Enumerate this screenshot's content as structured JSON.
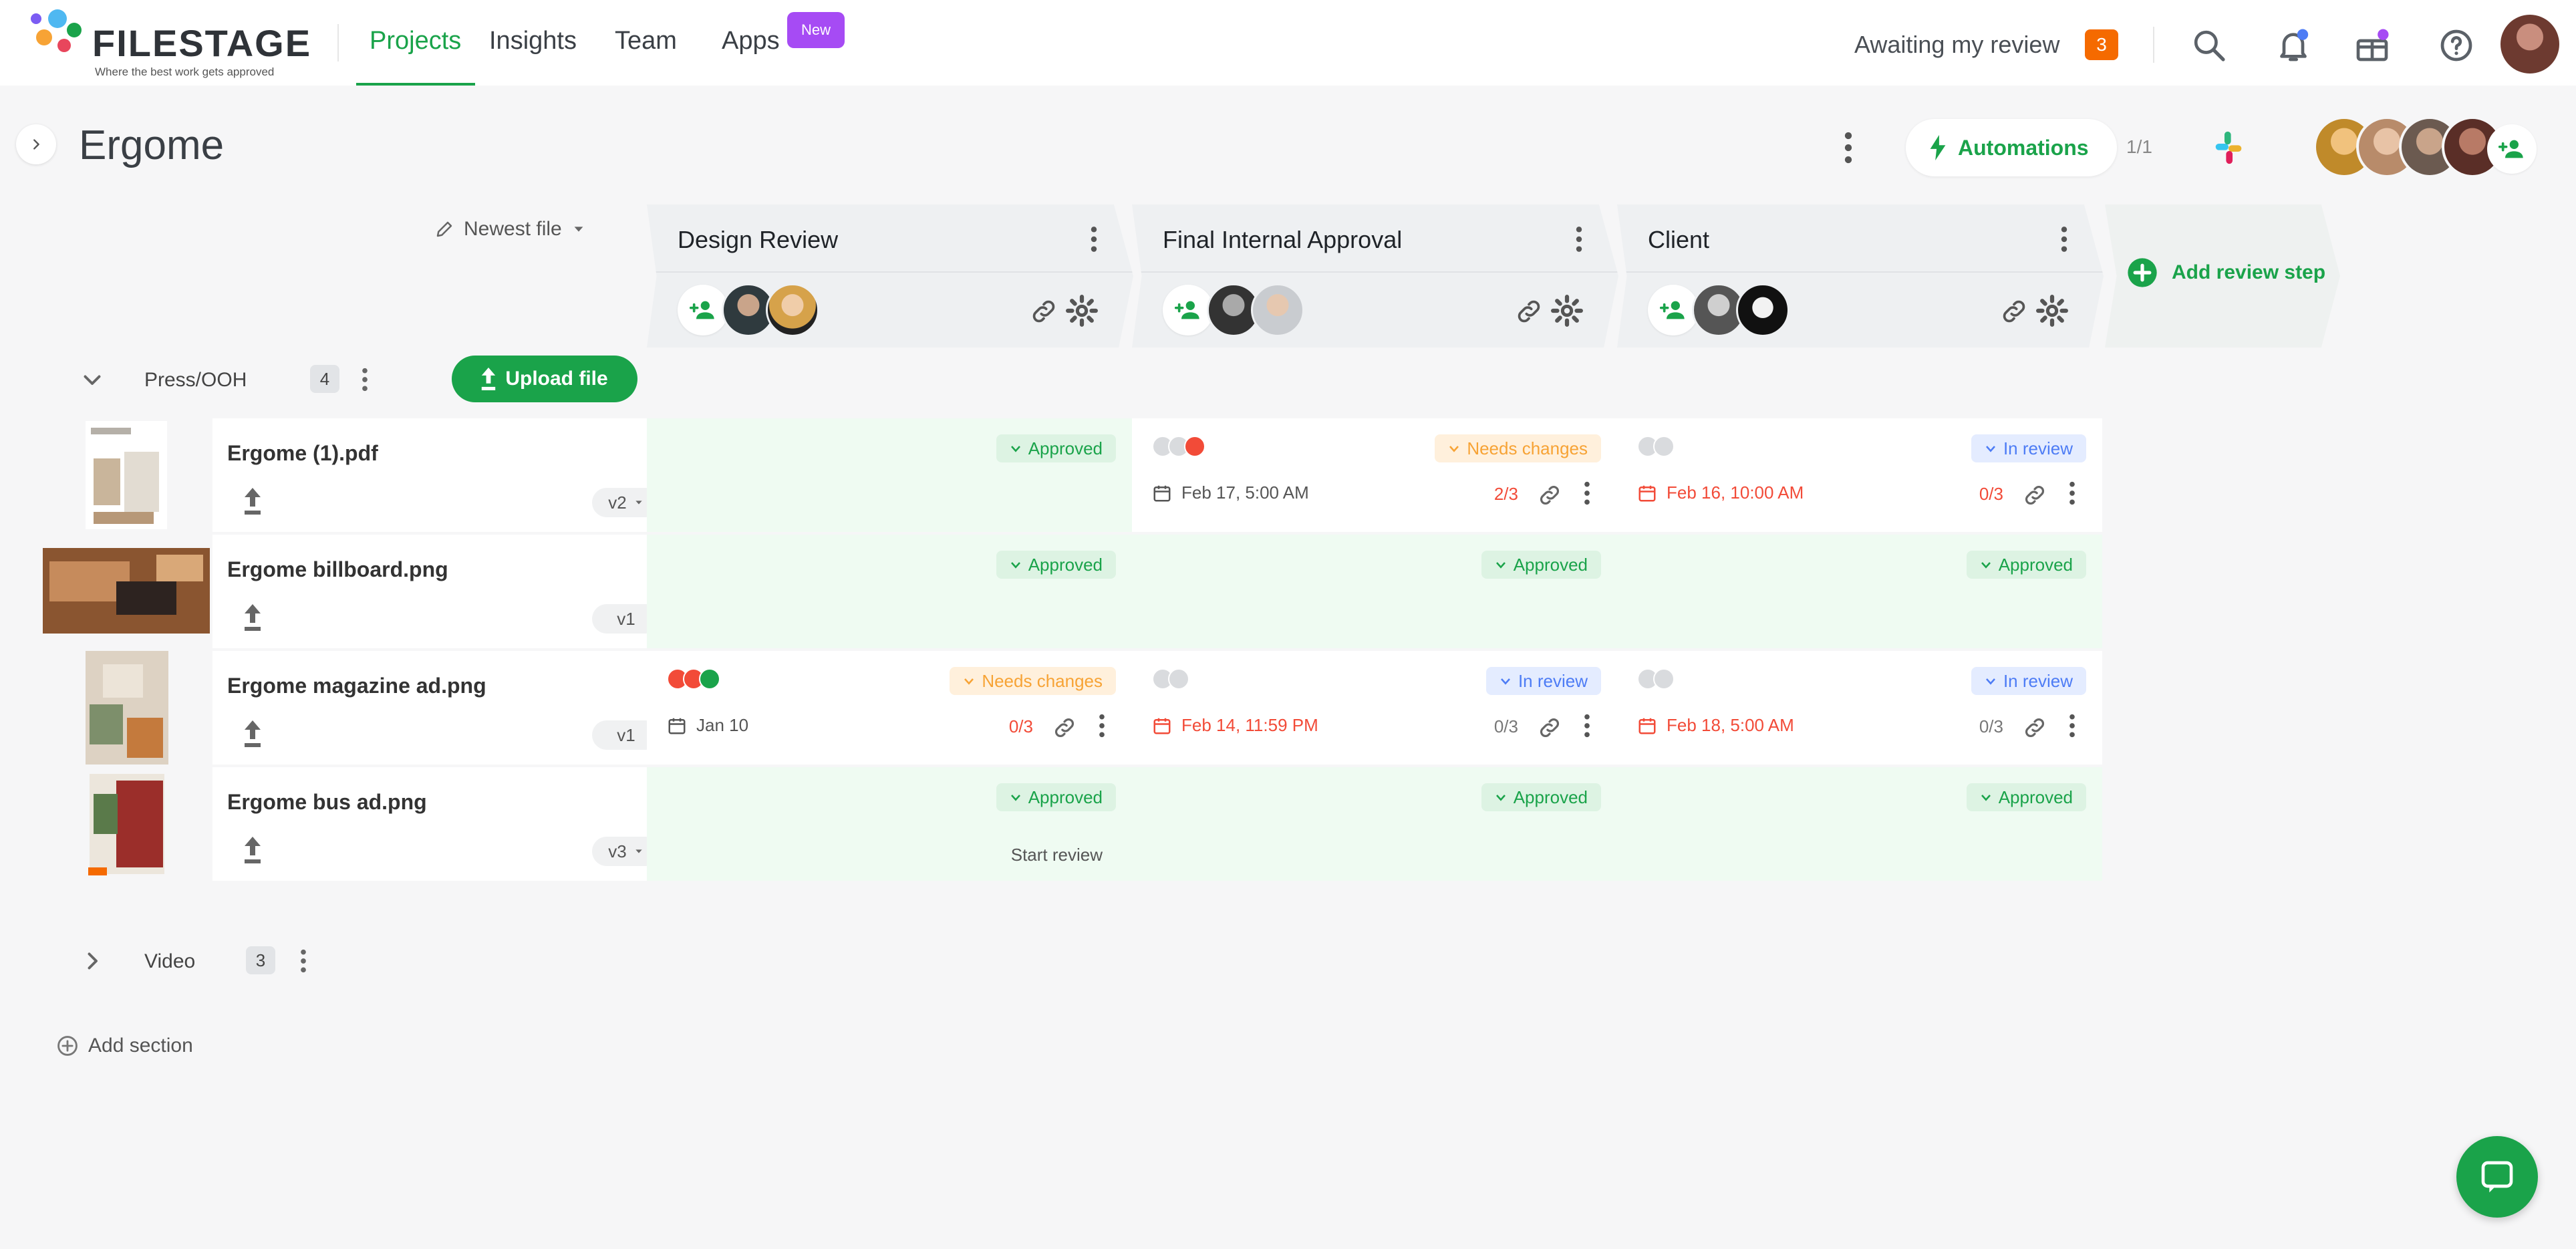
{
  "app": {
    "logo_text": "FILESTAGE",
    "logo_tagline": "Where the best work gets approved"
  },
  "nav": {
    "items": [
      "Projects",
      "Insights",
      "Team",
      "Apps"
    ],
    "new_badge": "New",
    "awaiting_label": "Awaiting my review",
    "awaiting_count": "3"
  },
  "project": {
    "title": "Ergome",
    "automations_label": "Automations",
    "automations_count": "1/1"
  },
  "sort": {
    "label": "Newest file"
  },
  "steps": [
    {
      "title": "Design Review"
    },
    {
      "title": "Final Internal Approval"
    },
    {
      "title": "Client"
    }
  ],
  "add_step_label": "Add review step",
  "sections": [
    {
      "name": "Press/OOH",
      "count": "4",
      "upload_label": "Upload file"
    },
    {
      "name": "Video",
      "count": "3"
    }
  ],
  "files": [
    {
      "name": "Ergome (1).pdf",
      "version": "v2",
      "cells": [
        {
          "status": "Approved"
        },
        {
          "status": "Needs changes",
          "due": "Feb 17, 5:00 AM",
          "ratio": "2/3"
        },
        {
          "status": "In review",
          "due": "Feb 16, 10:00 AM",
          "ratio": "0/3"
        }
      ]
    },
    {
      "name": "Ergome billboard.png",
      "version": "v1",
      "cells": [
        {
          "status": "Approved"
        },
        {
          "status": "Approved"
        },
        {
          "status": "Approved"
        }
      ]
    },
    {
      "name": "Ergome magazine ad.png",
      "version": "v1",
      "cells": [
        {
          "status": "Needs changes",
          "due": "Jan 10",
          "ratio": "0/3"
        },
        {
          "status": "In review",
          "due": "Feb 14, 11:59 PM",
          "ratio": "0/3"
        },
        {
          "status": "In review",
          "due": "Feb 18, 5:00 AM",
          "ratio": "0/3"
        }
      ]
    },
    {
      "name": "Ergome bus ad.png",
      "version": "v3",
      "cells": [
        {
          "status": "Approved",
          "action": "Start review"
        },
        {
          "status": "Approved"
        },
        {
          "status": "Approved"
        }
      ]
    }
  ],
  "add_section_label": "Add section",
  "colors": {
    "brand_green": "#1aa34a",
    "approved_bg": "#effbf2",
    "needs_changes": "#f7a335",
    "in_review": "#4d7cf5",
    "overdue": "#f24b38",
    "new_badge": "#a64bf4",
    "awaiting_badge": "#f56a00"
  }
}
